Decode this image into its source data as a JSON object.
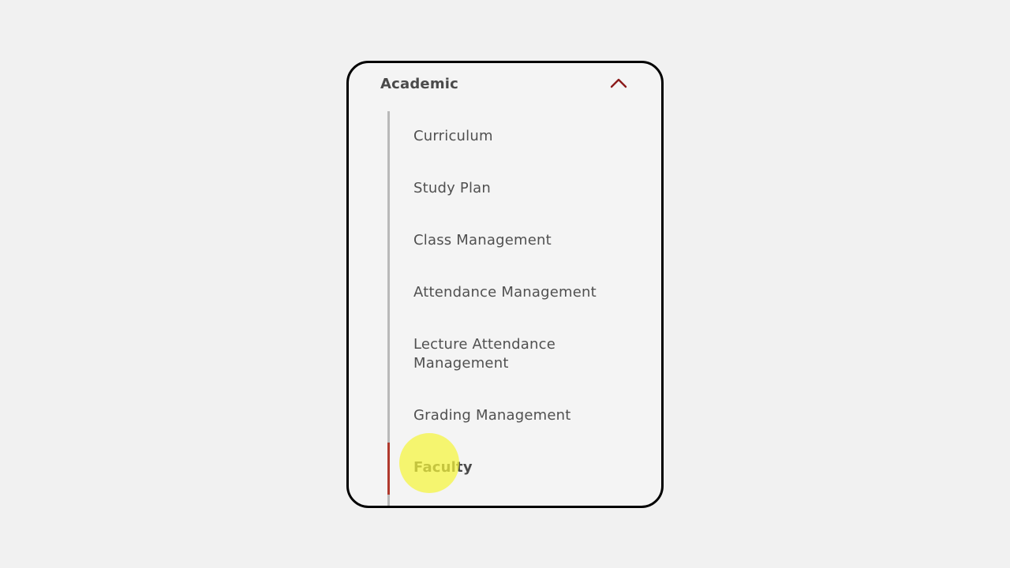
{
  "section": {
    "title": "Academic",
    "expanded": true,
    "chevron_icon": "chevron-up-icon",
    "accent_color": "#8b1a1a"
  },
  "nav": {
    "items": [
      {
        "label": "Curriculum"
      },
      {
        "label": "Study Plan"
      },
      {
        "label": "Class Management"
      },
      {
        "label": "Attendance Management"
      },
      {
        "label_line1": "Lecture Attendance",
        "label_line2": "Management"
      },
      {
        "label": "Grading Management"
      },
      {
        "label": "Faculty",
        "active": true
      }
    ],
    "active_indicator_color": "#b03a2e"
  },
  "cursor": {
    "highlight_color": "#f5f53c"
  }
}
